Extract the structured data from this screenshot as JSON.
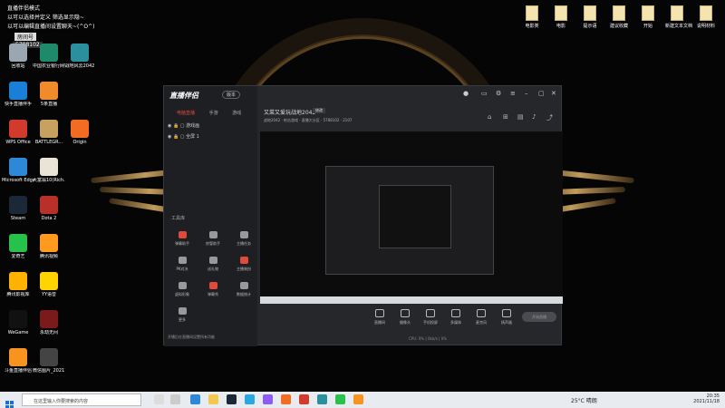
{
  "ticker": {
    "line1": "直播伴侣模式",
    "line2": "以可以选择并定义 筛选显示隐~",
    "line3": "以可以编辑直播间设置聊天~(^O^)"
  },
  "room": {
    "badge": "房间号",
    "number": "5788102"
  },
  "desktop_icons": [
    {
      "label": "回收站",
      "color": "#9aa6b2"
    },
    {
      "label": "中国农业银行网银助手",
      "color": "#1f8a6a"
    },
    {
      "label": "战地风云2042",
      "color": "#2b8f9e"
    },
    {
      "label": "快手直播伴手",
      "color": "#1a7fd6"
    },
    {
      "label": "5条直播",
      "color": "#f08a2a"
    },
    {
      "label": "WPS Office",
      "color": "#d23b2c"
    },
    {
      "label": "BATTLEGR...",
      "color": "#c8a060"
    },
    {
      "label": "Origin",
      "color": "#f26d21"
    },
    {
      "label": "Microsoft Edge",
      "color": "#2e88d8"
    },
    {
      "label": "大富翁10(Rich...",
      "color": "#e9e4d6"
    },
    {
      "label": "Steam",
      "color": "#1b2838"
    },
    {
      "label": "Dota 2",
      "color": "#b8302a"
    },
    {
      "label": "爱奇艺",
      "color": "#27c24c"
    },
    {
      "label": "腾讯视频",
      "color": "#ff9a1f"
    },
    {
      "label": "腾讯影视库",
      "color": "#ffb300"
    },
    {
      "label": "YY语音",
      "color": "#ffd400"
    },
    {
      "label": "WeGame",
      "color": "#111"
    },
    {
      "label": "永劫无间",
      "color": "#7a1a1a"
    },
    {
      "label": "斗鱼直播伴侣",
      "color": "#f7931e"
    },
    {
      "label": "微信图片_20211111...",
      "color": "#444"
    }
  ],
  "files": [
    "电影类",
    "电影",
    "提示语",
    "建议收藏",
    "开始",
    "新建文本文档",
    "说明材料"
  ],
  "app": {
    "logo": "直播伴侣",
    "version": "版本",
    "sidebar_tabs": [
      "电脑直播",
      "手游",
      "游戏"
    ],
    "scenes": [
      "游戏画",
      "全屏 1"
    ],
    "tools_title": "工具库",
    "tools": [
      {
        "label": "弹幕助手",
        "color": "#e04a3a"
      },
      {
        "label": "房管助手",
        "color": "#999"
      },
      {
        "label": "主播任务",
        "color": "#999"
      },
      {
        "label": "PK对决",
        "color": "#999"
      },
      {
        "label": "送礼物",
        "color": "#999"
      },
      {
        "label": "主播装扮",
        "color": "#e04a3a"
      },
      {
        "label": "虚拟形象",
        "color": "#999"
      },
      {
        "label": "弹幕秀",
        "color": "#e04a3a"
      },
      {
        "label": "数据统计",
        "color": "#999"
      },
      {
        "label": "更多",
        "color": "#999"
      }
    ],
    "tip": "开播后在直播间设置所有功能",
    "stream_title": "又菜又爱玩战地2042",
    "title_tag": "修改",
    "category": "战地2042 · 射击游戏 · 直播大分区 · 5788102 · 2107",
    "bottom_tools": [
      "直播间",
      "摄像头",
      "手机投屏",
      "多媒体",
      "麦克风",
      "扬声器"
    ],
    "start_live": "开始直播",
    "status": "CPU: 0% | 0kb/s | 0%"
  },
  "taskbar": {
    "search_placeholder": "在这里输入你要搜索的内容",
    "weather": "25°C 晴朗",
    "time": "20:35",
    "date": "2021/11/18"
  }
}
